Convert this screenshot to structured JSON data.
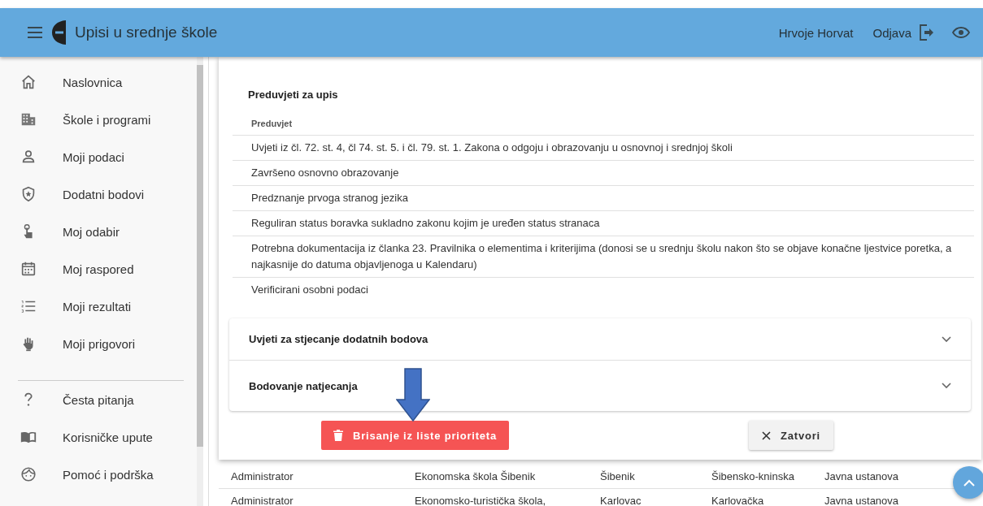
{
  "header": {
    "title": "Upisi u srednje škole",
    "user": "Hrvoje Horvat",
    "logout": "Odjava"
  },
  "sidebar": {
    "items": [
      {
        "label": "Naslovnica",
        "kind": "home"
      },
      {
        "label": "Škole i programi",
        "kind": "building"
      },
      {
        "label": "Moji podaci",
        "kind": "person"
      },
      {
        "label": "Dodatni bodovi",
        "kind": "shield"
      },
      {
        "label": "Moj odabir",
        "kind": "pointer"
      },
      {
        "label": "Moj raspored",
        "kind": "calendar"
      },
      {
        "label": "Moji rezultati",
        "kind": "list"
      },
      {
        "label": "Moji prigovori",
        "kind": "hand"
      }
    ],
    "secondary_items": [
      {
        "label": "Česta pitanja",
        "kind": "question"
      },
      {
        "label": "Korisničke upute",
        "kind": "book"
      },
      {
        "label": "Pomoć i podrška",
        "kind": "face"
      }
    ]
  },
  "dialog": {
    "section_title": "Preduvjeti za upis",
    "table": {
      "columns": [
        "Preduvjet"
      ],
      "rows": [
        "Uvjeti iz čl. 72. st. 4, čl 74. st. 5. i čl. 79. st. 1. Zakona o odgoju i obrazovanju u osnovnoj i srednjoj školi",
        "Završeno osnovno obrazovanje",
        "Predznanje prvoga stranog jezika",
        "Reguliran status boravka sukladno zakonu kojim je uređen status stranaca",
        "Potrebna dokumentacija iz članka 23. Pravilnika o elementima i kriterijima (donosi se u srednju školu nakon što se objave konačne ljestvice poretka, a najkasnije do datuma objavljenoga u Kalendaru)",
        "Verificirani osobni podaci"
      ]
    },
    "panels": [
      {
        "title": "Uvjeti za stjecanje dodatnih bodova",
        "expanded": false
      },
      {
        "title": "Bodovanje natjecanja",
        "expanded": false
      }
    ],
    "buttons": [
      {
        "label": "Brisanje iz liste prioriteta",
        "kind": "danger"
      },
      {
        "label": "Zatvori",
        "kind": "plain"
      }
    ]
  },
  "background_table": {
    "rows": [
      [
        "Administrator",
        "Ekonomska škola Šibenik",
        "Šibenik",
        "Šibensko-kninska",
        "Javna ustanova"
      ],
      [
        "Administrator",
        "Ekonomsko-turistička škola,",
        "Karlovac",
        "Karlovačka",
        "Javna ustanova"
      ]
    ]
  }
}
